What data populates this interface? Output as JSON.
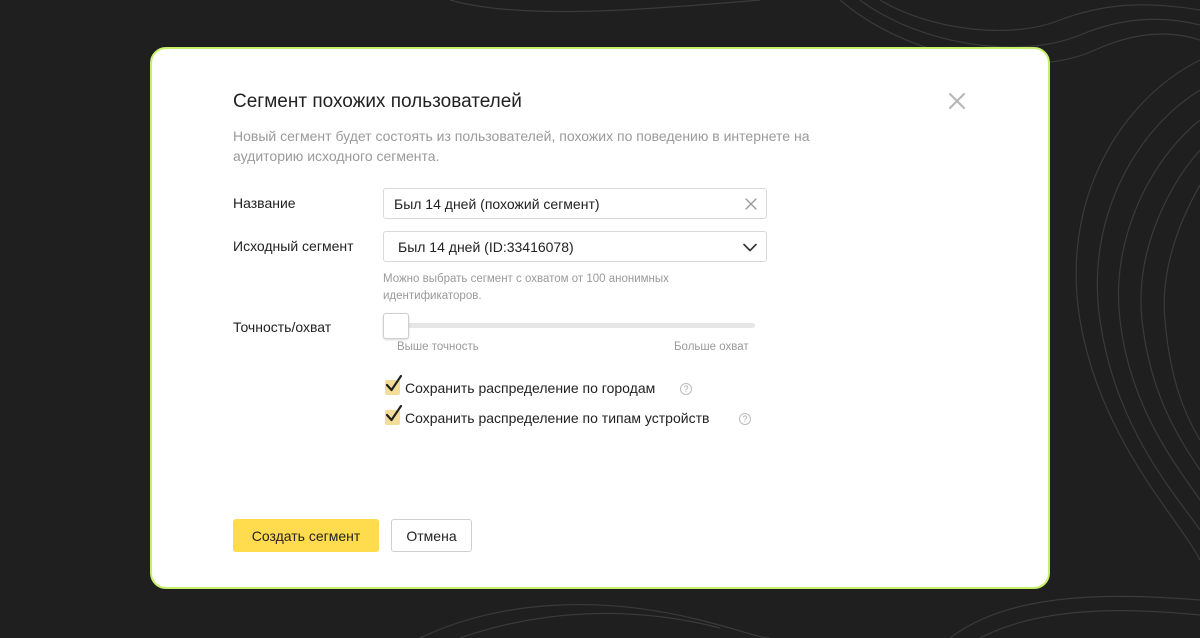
{
  "modal": {
    "title": "Сегмент похожих пользователей",
    "subtitle": "Новый сегмент будет состоять из пользователей, похожих по поведению в интернете на аудиторию исходного сегмента.",
    "accent_border": "#c6f06b"
  },
  "form": {
    "name_label": "Название",
    "name_value": "Был 14 дней (похожий сегмент)",
    "source_label": "Исходный сегмент",
    "source_value": "Был 14 дней (ID:33416078)",
    "source_hint": "Можно выбрать сегмент с охватом от 100 анонимных идентификаторов.",
    "accuracy_label": "Точность/охват",
    "slider_left": "Выше точность",
    "slider_right": "Больше охват",
    "slider_value": 0,
    "check_cities": "Сохранить распределение по городам",
    "check_cities_checked": true,
    "check_devices": "Сохранить распределение по типам устройств",
    "check_devices_checked": true
  },
  "buttons": {
    "create": "Создать сегмент",
    "cancel": "Отмена",
    "primary_color": "#ffdb4d"
  },
  "icons": {
    "close": "close-icon",
    "clear": "clear-icon",
    "dropdown": "chevron-down-icon",
    "help": "help-icon",
    "check": "checkmark-icon"
  }
}
